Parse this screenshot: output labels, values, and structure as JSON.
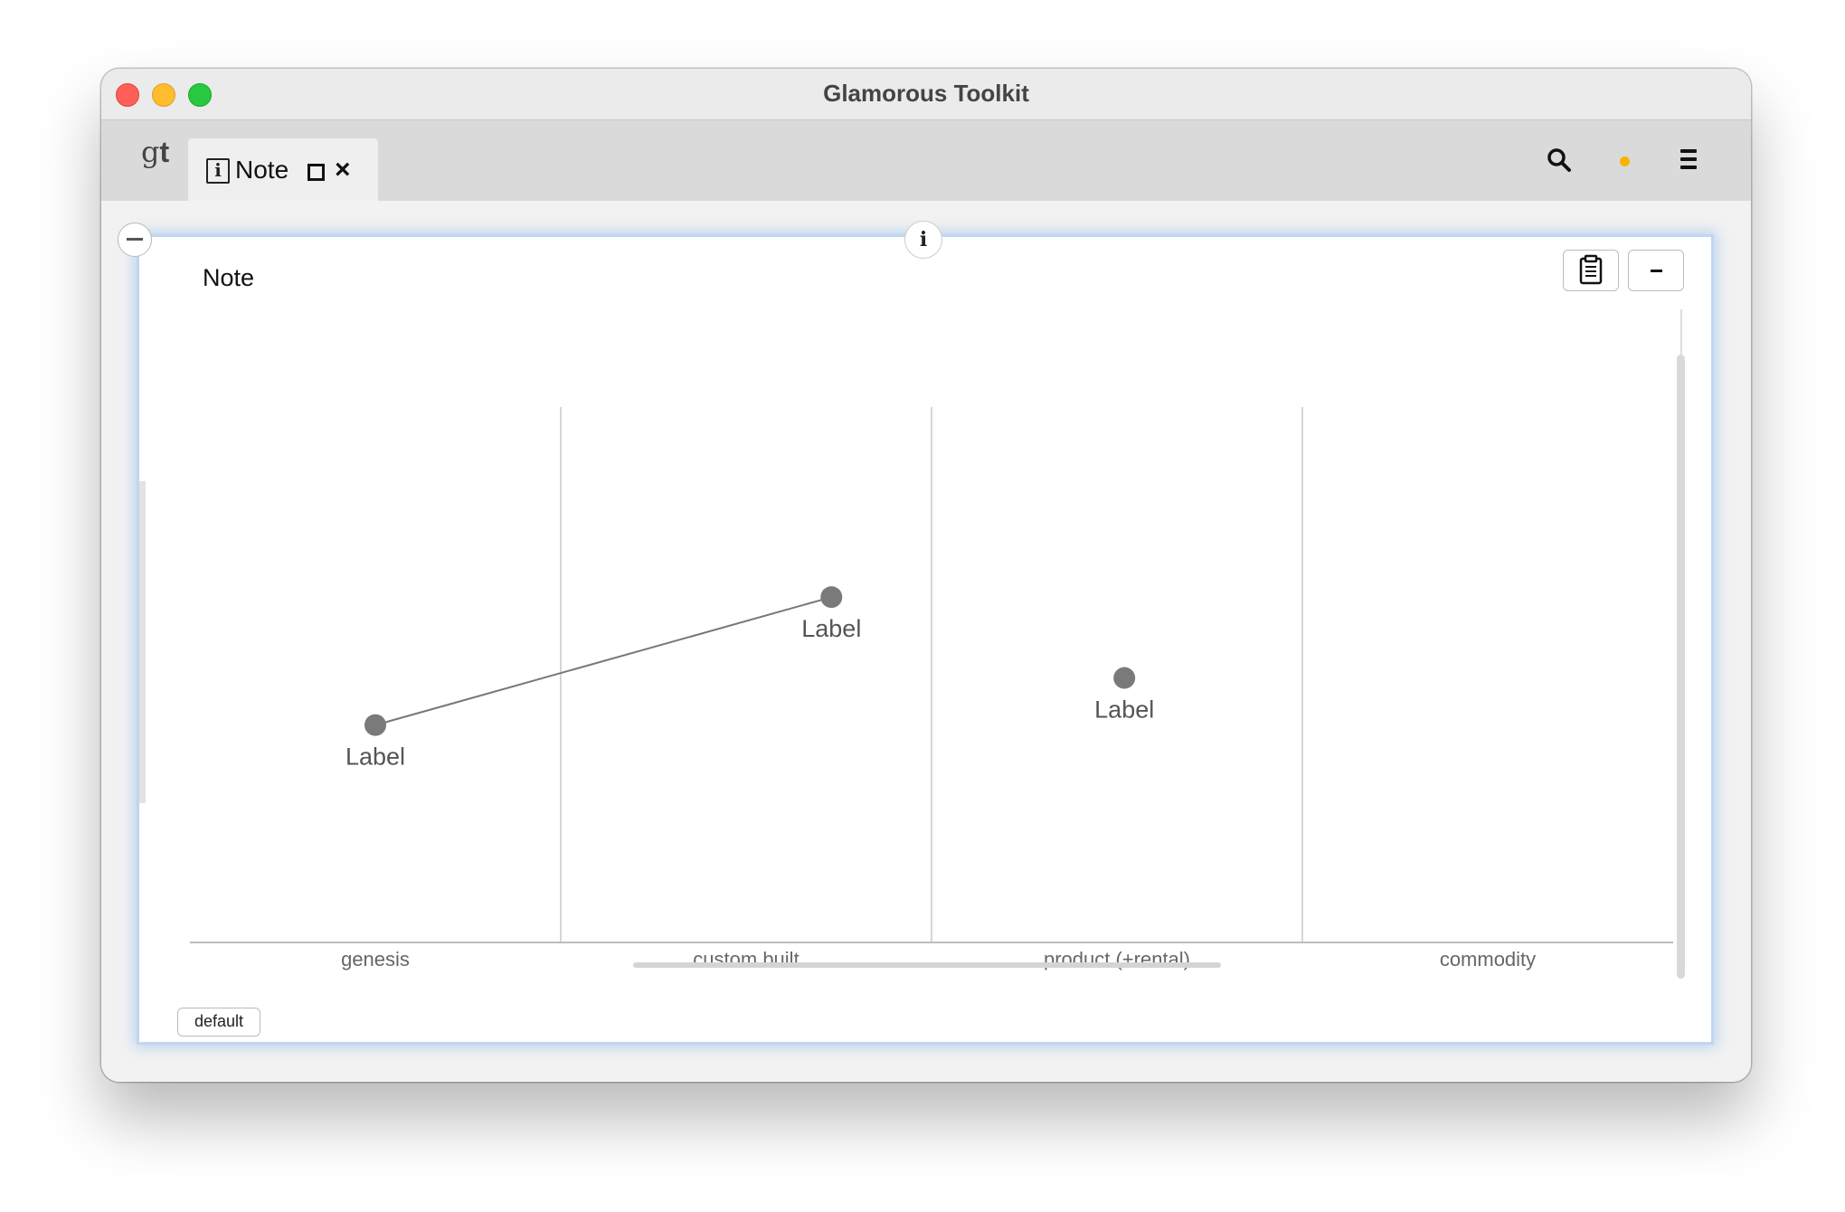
{
  "window": {
    "title": "Glamorous Toolkit"
  },
  "tabbar": {
    "logo_g": "g",
    "logo_t": "t",
    "note_tab": {
      "icon_glyph": "i",
      "label": "Note"
    },
    "status_color": "#f8b500"
  },
  "pane": {
    "title": "Note",
    "info_glyph": "i",
    "toolbar_buttons": [
      "clipboard-icon",
      "minus-icon"
    ],
    "footer_button": "default"
  },
  "chart_data": {
    "type": "scatter",
    "title": "",
    "categories": [
      "genesis",
      "custom built",
      "product (+rental)",
      "commodity"
    ],
    "points": [
      {
        "label": "Label",
        "x": 0.5,
        "y": 0.406
      },
      {
        "label": "Label",
        "x": 1.73,
        "y": 0.645
      },
      {
        "label": "Label",
        "x": 2.52,
        "y": 0.494
      }
    ],
    "links": [
      [
        0,
        1
      ]
    ],
    "xlim": [
      0,
      4
    ],
    "ylim": [
      0,
      1
    ],
    "grid": "vertical category separators",
    "point_color": "#7a7a7a",
    "line_color": "#777777"
  }
}
